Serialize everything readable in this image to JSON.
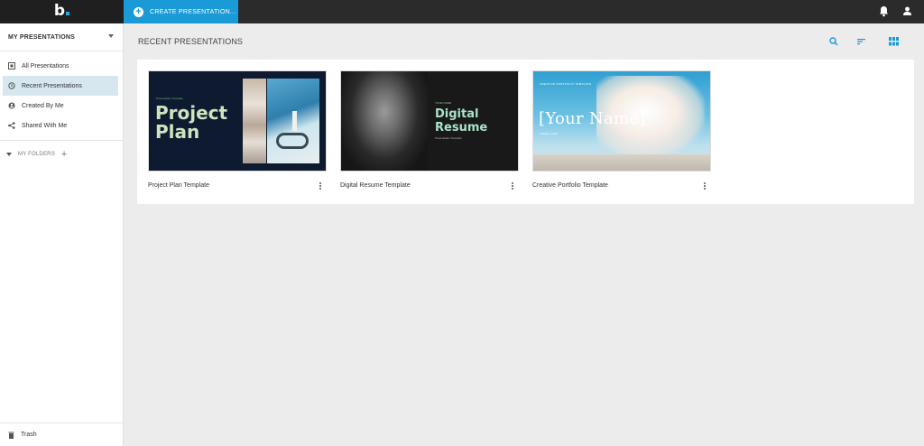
{
  "brand": {
    "logo": "b"
  },
  "topbar": {
    "create_label": "CREATE PRESENTATION...",
    "icons": [
      "bell-icon",
      "user-icon"
    ]
  },
  "sidebar": {
    "header": "MY PRESENTATIONS",
    "items": [
      {
        "label": "All Presentations",
        "icon": "grid-icon",
        "active": false
      },
      {
        "label": "Recent Presentations",
        "icon": "history-icon",
        "active": true
      },
      {
        "label": "Created By Me",
        "icon": "person-icon",
        "active": false
      },
      {
        "label": "Shared With Me",
        "icon": "share-icon",
        "active": false
      }
    ],
    "folders_label": "MY FOLDERS",
    "trash_label": "Trash"
  },
  "main": {
    "title": "RECENT PRESENTATIONS",
    "tools": [
      "search-icon",
      "sort-icon",
      "grid-view-icon"
    ]
  },
  "cards": [
    {
      "title": "Project Plan Template",
      "thumb": {
        "small": "Presentation Template",
        "big_line1": "Project",
        "big_line2": "Plan"
      }
    },
    {
      "title": "Digital Resume Template",
      "thumb": {
        "small": "YOUR NAME",
        "big_line1": "Digital",
        "big_line2": "Resume",
        "sub": "Presentation Template"
      }
    },
    {
      "title": "Creative Portfolio Template",
      "thumb": {
        "small": "CREATIVE PORTFOLIO TEMPLATE",
        "big": "[Your Name]",
        "sub": "website | email"
      }
    }
  ],
  "colors": {
    "accent": "#1a9ad6",
    "topbar": "#2b2b2b",
    "active_item": "#d7e7f0"
  }
}
